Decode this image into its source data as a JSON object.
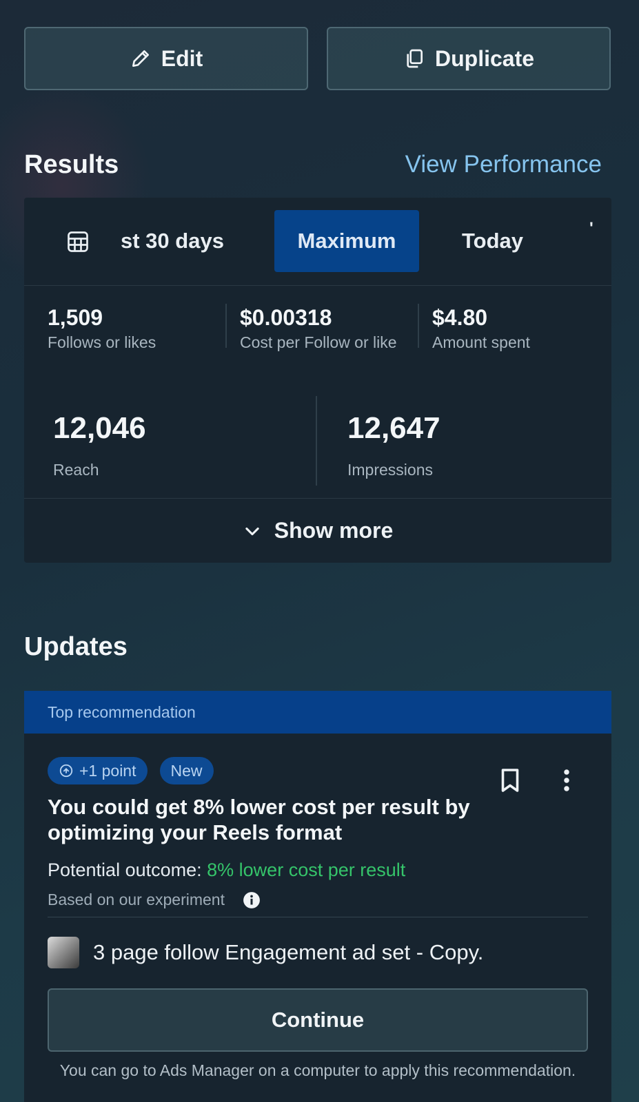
{
  "actions": {
    "edit_label": "Edit",
    "duplicate_label": "Duplicate"
  },
  "results": {
    "title": "Results",
    "view_link": "View Performance",
    "tabs": {
      "range_30": "st 30 days",
      "maximum": "Maximum",
      "today": "Today",
      "overflow": "'"
    },
    "selected_tab": "Maximum",
    "metrics_row1": [
      {
        "value": "1,509",
        "label": "Follows or likes"
      },
      {
        "value": "$0.00318",
        "label": "Cost per Follow or like"
      },
      {
        "value": "$4.80",
        "label": "Amount spent"
      }
    ],
    "metrics_row2": [
      {
        "value": "12,046",
        "label": "Reach"
      },
      {
        "value": "12,647",
        "label": "Impressions"
      }
    ],
    "show_more": "Show more"
  },
  "updates": {
    "title": "Updates",
    "banner": "Top recommendation",
    "pill_points": "+1 point",
    "pill_new": "New",
    "headline": "You could get 8% lower cost per result by optimizing your Reels format",
    "outcome_prefix": "Potential outcome: ",
    "outcome_value": "8% lower cost per result",
    "basis": "Based on our experiment",
    "adset_name": "3 page follow Engagement ad set - Copy.",
    "continue_label": "Continue",
    "footnote": "You can go to Ads Manager on a computer to apply this recommendation."
  },
  "icons": {
    "edit": "pencil-icon",
    "duplicate": "copy-icon",
    "calendar": "calendar-icon",
    "chevron": "chevron-down-icon",
    "points": "arrow-up-circle-icon",
    "bookmark": "bookmark-icon",
    "more": "more-vertical-icon",
    "info": "info-icon"
  },
  "colors": {
    "accent_blue": "#06438a",
    "link": "#86c4ee",
    "positive": "#35c46a"
  }
}
